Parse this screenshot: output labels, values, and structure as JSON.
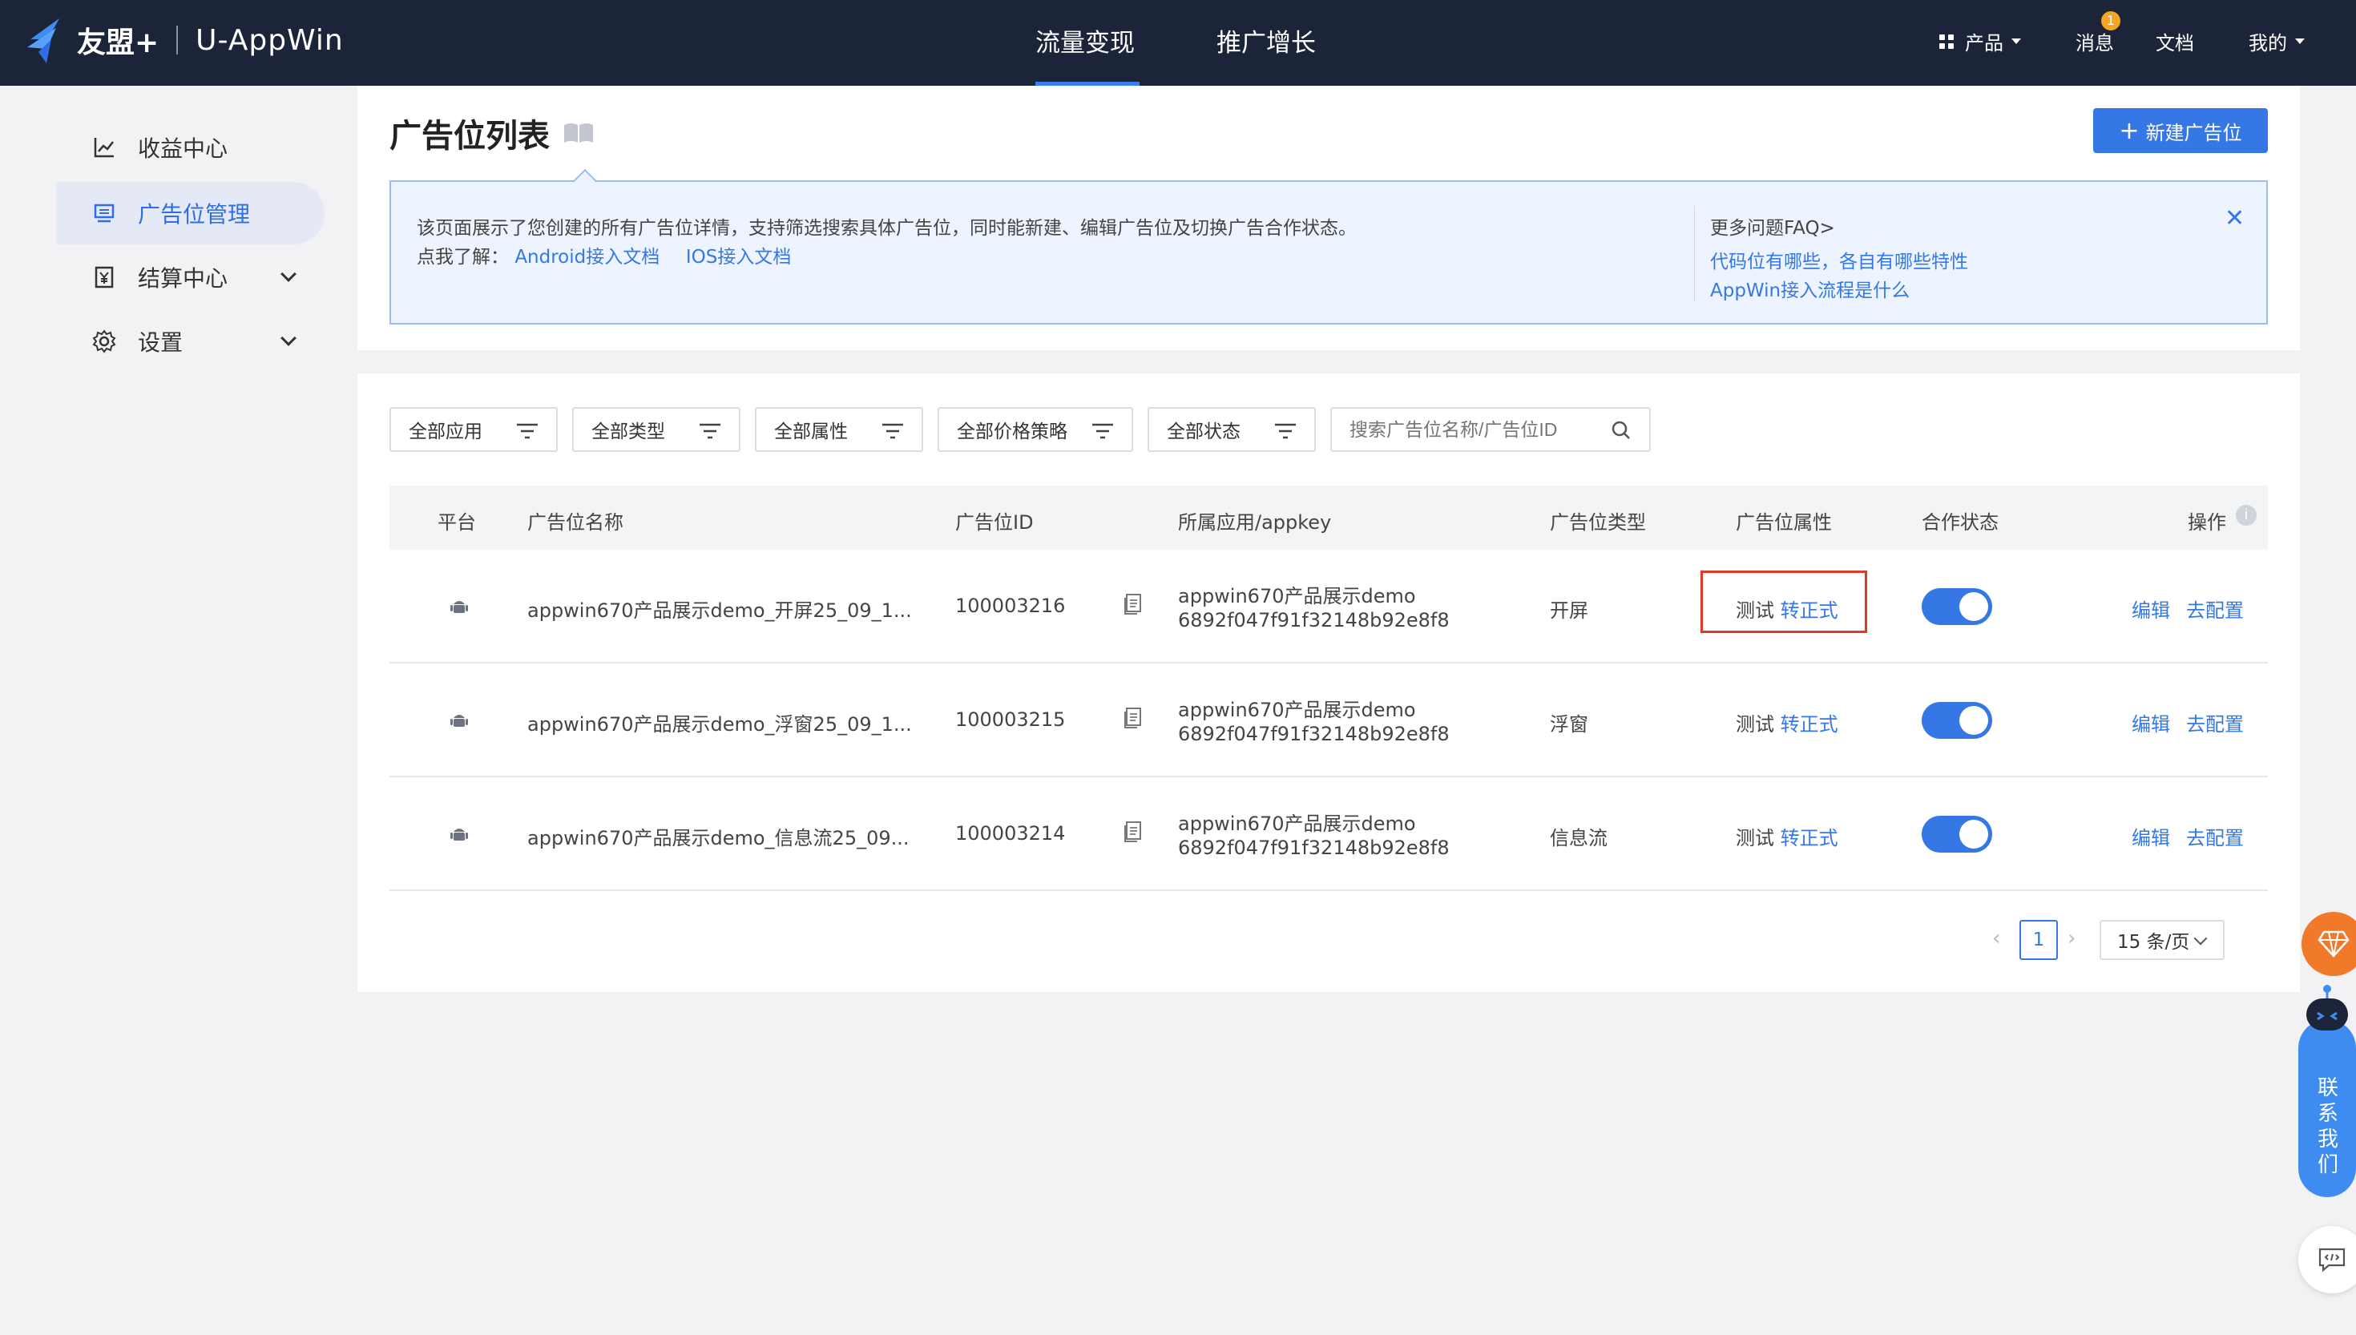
{
  "app": {
    "brand": "友盟+",
    "product": "U-AppWin"
  },
  "top_tabs": [
    {
      "label": "流量变现",
      "active": true
    },
    {
      "label": "推广增长",
      "active": false
    }
  ],
  "top_right": {
    "products": "产品",
    "messages": "消息",
    "message_badge": "1",
    "docs": "文档",
    "mine": "我的"
  },
  "sidebar": {
    "items": [
      {
        "label": "收益中心",
        "icon": "line-chart-icon",
        "active": false
      },
      {
        "label": "广告位管理",
        "icon": "monitor-icon",
        "active": true
      },
      {
        "label": "结算中心",
        "icon": "yen-icon",
        "active": false,
        "expandable": true
      },
      {
        "label": "设置",
        "icon": "gear-icon",
        "active": false,
        "expandable": true
      }
    ]
  },
  "page": {
    "title": "广告位列表",
    "new_button": "新建广告位"
  },
  "info": {
    "description": "该页面展示了您创建的所有广告位详情，支持筛选搜索具体广告位，同时能新建、编辑广告位及切换广告合作状态。",
    "learn_prefix": "点我了解：",
    "android_doc": "Android接入文档",
    "ios_doc": "IOS接入文档",
    "faq_title": "更多问题FAQ>",
    "faq_1": "代码位有哪些，各自有哪些特性",
    "faq_2": "AppWin接入流程是什么"
  },
  "filters": {
    "app": "全部应用",
    "type": "全部类型",
    "attr": "全部属性",
    "price": "全部价格策略",
    "status": "全部状态",
    "search_placeholder": "搜索广告位名称/广告位ID"
  },
  "table": {
    "headers": {
      "platform": "平台",
      "name": "广告位名称",
      "id": "广告位ID",
      "app": "所属应用/appkey",
      "type": "广告位类型",
      "attr": "广告位属性",
      "status": "合作状态",
      "ops": "操作"
    },
    "rows": [
      {
        "name": "appwin670产品展示demo_开屏25_09_1...",
        "id": "100003216",
        "app": "appwin670产品展示demo",
        "appkey": "6892f047f91f32148b92e8f8",
        "type": "开屏",
        "attr_test": "测试",
        "attr_switch": "转正式",
        "status_on": true,
        "edit": "编辑",
        "config": "去配置"
      },
      {
        "name": "appwin670产品展示demo_浮窗25_09_1...",
        "id": "100003215",
        "app": "appwin670产品展示demo",
        "appkey": "6892f047f91f32148b92e8f8",
        "type": "浮窗",
        "attr_test": "测试",
        "attr_switch": "转正式",
        "status_on": true,
        "edit": "编辑",
        "config": "去配置"
      },
      {
        "name": "appwin670产品展示demo_信息流25_09...",
        "id": "100003214",
        "app": "appwin670产品展示demo",
        "appkey": "6892f047f91f32148b92e8f8",
        "type": "信息流",
        "attr_test": "测试",
        "attr_switch": "转正式",
        "status_on": true,
        "edit": "编辑",
        "config": "去配置"
      }
    ]
  },
  "pagination": {
    "current_page": "1",
    "page_size": "15 条/页"
  },
  "floating": {
    "contact": "联系我们"
  },
  "colors": {
    "nav_bg": "#1b2438",
    "accent": "#3578e5",
    "highlight_box": "#e03b2a",
    "gem": "#f07a2a"
  }
}
